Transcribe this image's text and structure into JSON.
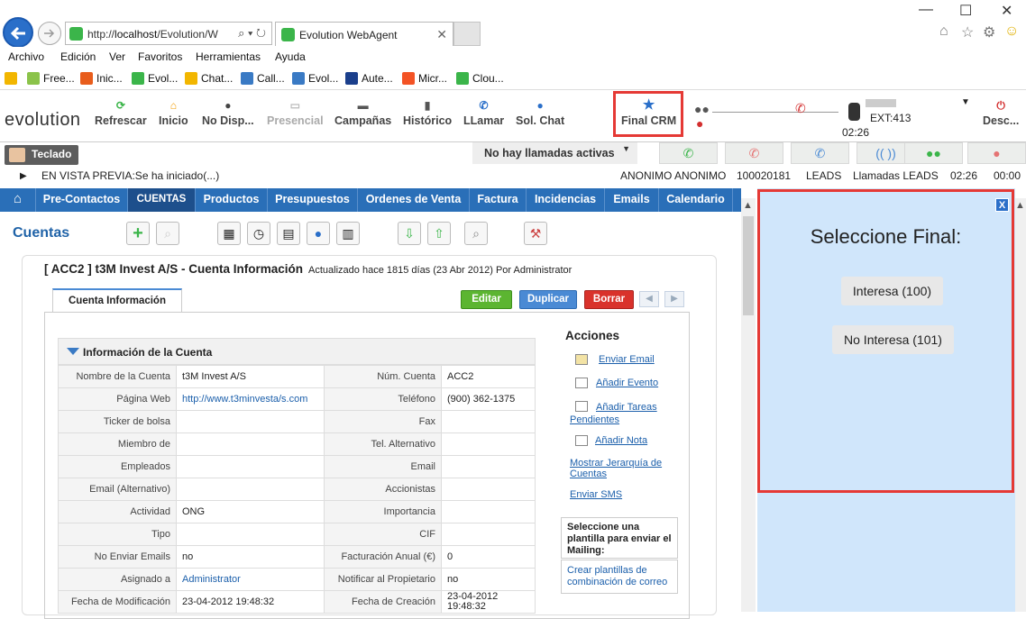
{
  "browser": {
    "url_prefix": "http://",
    "url_host": "localhost",
    "url_rest": "/Evolution/W",
    "tab_title": "Evolution WebAgent"
  },
  "menu": [
    "Archivo",
    "Edición",
    "Ver",
    "Favoritos",
    "Herramientas",
    "Ayuda"
  ],
  "favorites": [
    "Free...",
    "Inic...",
    "Evol...",
    "Chat...",
    "Call...",
    "Evol...",
    "Aute...",
    "Micr...",
    "Clou..."
  ],
  "app_toolbar": {
    "logo": "evolution",
    "buttons": [
      "Refrescar",
      "Inicio",
      "No Disp...",
      "Presencial",
      "Campañas",
      "Histórico",
      "LLamar",
      "Sol. Chat",
      "Final CRM"
    ],
    "timer": "02:26",
    "ext": "EXT:413",
    "desc": "Desc..."
  },
  "status": {
    "teclado": "Teclado",
    "no_calls": "No hay llamadas activas"
  },
  "infobar": {
    "preview": "EN VISTA PREVIA:Se ha iniciado(...)",
    "name": "ANONIMO ANONIMO",
    "number": "100020181",
    "leads": "LEADS",
    "campaign": "Llamadas LEADS",
    "time1": "02:26",
    "time2": "00:00"
  },
  "nav": [
    "Pre-Contactos",
    "CUENTAS",
    "Productos",
    "Presupuestos",
    "Ordenes de Venta",
    "Factura",
    "Incidencias",
    "Emails",
    "Calendario"
  ],
  "main": {
    "section_title": "Cuentas",
    "record_title": "[ ACC2 ] t3M Invest A/S - Cuenta Información",
    "updated": "Actualizado hace 1815 días (23 Abr 2012) Por Administrator",
    "tab": "Cuenta Información",
    "btn_edit": "Editar",
    "btn_dup": "Duplicar",
    "btn_del": "Borrar",
    "block_title": "Información de la Cuenta",
    "rows": [
      [
        "Nombre de la Cuenta",
        "t3M Invest A/S",
        "Núm. Cuenta",
        "ACC2"
      ],
      [
        "Página Web",
        "http://www.t3minvesta/s.com",
        "Teléfono",
        "(900) 362-1375"
      ],
      [
        "Ticker de bolsa",
        "",
        "Fax",
        ""
      ],
      [
        "Miembro de",
        "",
        "Tel. Alternativo",
        ""
      ],
      [
        "Empleados",
        "",
        "Email",
        ""
      ],
      [
        "Email (Alternativo)",
        "",
        "Accionistas",
        ""
      ],
      [
        "Actividad",
        "ONG",
        "Importancia",
        ""
      ],
      [
        "Tipo",
        "",
        "CIF",
        ""
      ],
      [
        "No Enviar Emails",
        "no",
        "Facturación Anual (€)",
        "0"
      ],
      [
        "Asignado a",
        "Administrator",
        "Notificar al Propietario",
        "no"
      ],
      [
        "Fecha de Modificación",
        "23-04-2012 19:48:32",
        "Fecha de Creación",
        "23-04-2012 19:48:32"
      ]
    ],
    "acciones": "Acciones",
    "actions": [
      "Enviar Email",
      "Añadir Evento",
      "Añadir Tareas Pendientes",
      "Añadir Nota",
      "Mostrar Jerarquía de Cuentas",
      "Enviar SMS"
    ],
    "mailing_label": "Seleccione una plantilla para enviar el Mailing:",
    "mailing_link": "Crear plantillas de combinación de correo"
  },
  "right_panel": {
    "close": "X",
    "title": "Seleccione Final:",
    "opt1": "Interesa (100)",
    "opt2": "No Interesa (101)"
  },
  "colors": {
    "nav_bg": "#2a6fb8",
    "highlight": "#e53935",
    "panel_bg": "#d0e6fb",
    "edit": "#5cb531",
    "duplicate": "#4a8ad4",
    "delete": "#d9322b"
  }
}
